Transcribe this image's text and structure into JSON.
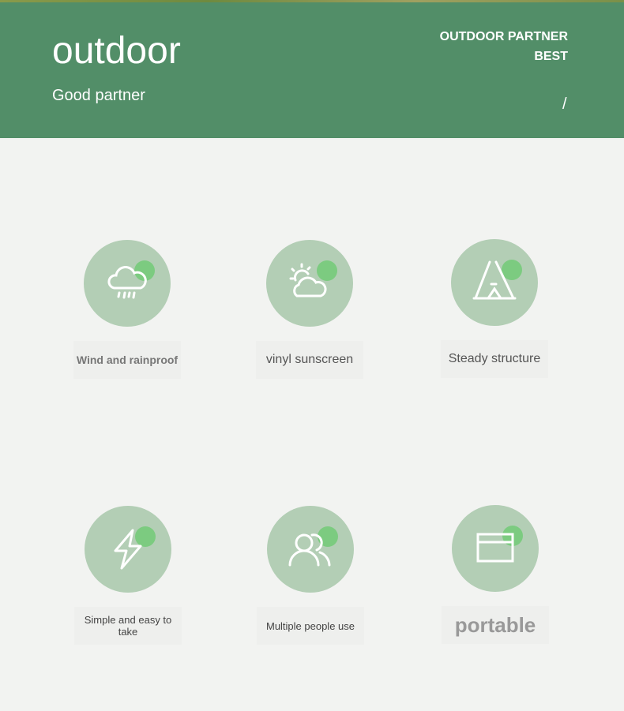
{
  "header": {
    "title": "outdoor",
    "subtitle": "Good partner",
    "tagline_1": "OUTDOOR PARTNER",
    "tagline_2": "BEST",
    "slash": "/"
  },
  "features": [
    {
      "label": "Wind and rainproof",
      "icon": "cloud-rain-icon"
    },
    {
      "label": "vinyl sunscreen",
      "icon": "sun-cloud-icon"
    },
    {
      "label": "Steady structure",
      "icon": "tent-icon"
    },
    {
      "label": "Simple and easy to take",
      "icon": "lightning-icon"
    },
    {
      "label": "Multiple people use",
      "icon": "people-icon"
    },
    {
      "label": "portable",
      "icon": "window-icon"
    }
  ],
  "colors": {
    "header": "#528e68",
    "circle": "#b3ceb5",
    "dot": "#7ccb80"
  }
}
